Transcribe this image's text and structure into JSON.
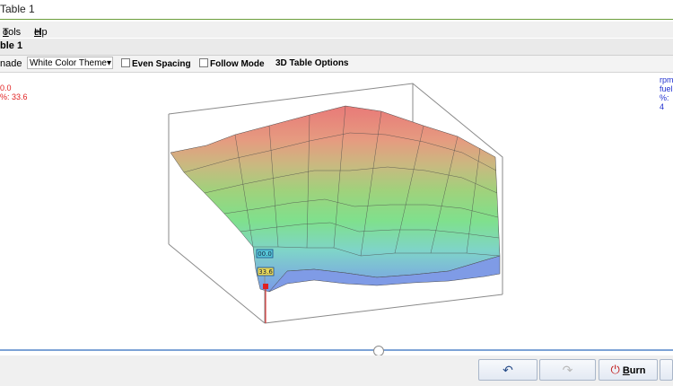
{
  "window": {
    "title": "Table 1"
  },
  "menu": {
    "items": [
      "Tools",
      "Help"
    ]
  },
  "tab": {
    "label": "ble 1"
  },
  "toolbar": {
    "mode_label": "nade",
    "theme_value": "White Color Theme",
    "even_spacing": "Even Spacing",
    "follow_mode": "Follow Mode",
    "table_options": "3D Table Options"
  },
  "readout_left": {
    "line1": "0.0",
    "line2": "%: 33.6"
  },
  "readout_right": {
    "line1": "rpm",
    "line2": "fuel",
    "line3": "%: 4"
  },
  "markers": {
    "top": "00.0",
    "bottom": "33.6"
  },
  "slider": {
    "position": 0.56
  },
  "buttons": {
    "undo_icon": "undo-icon",
    "redo_icon": "redo-icon",
    "burn_label": "Burn"
  },
  "colors": {
    "accent": "#6c9e3c",
    "slider": "#7da3d6",
    "readout_left": "#e02020",
    "readout_right": "#2030d0"
  }
}
